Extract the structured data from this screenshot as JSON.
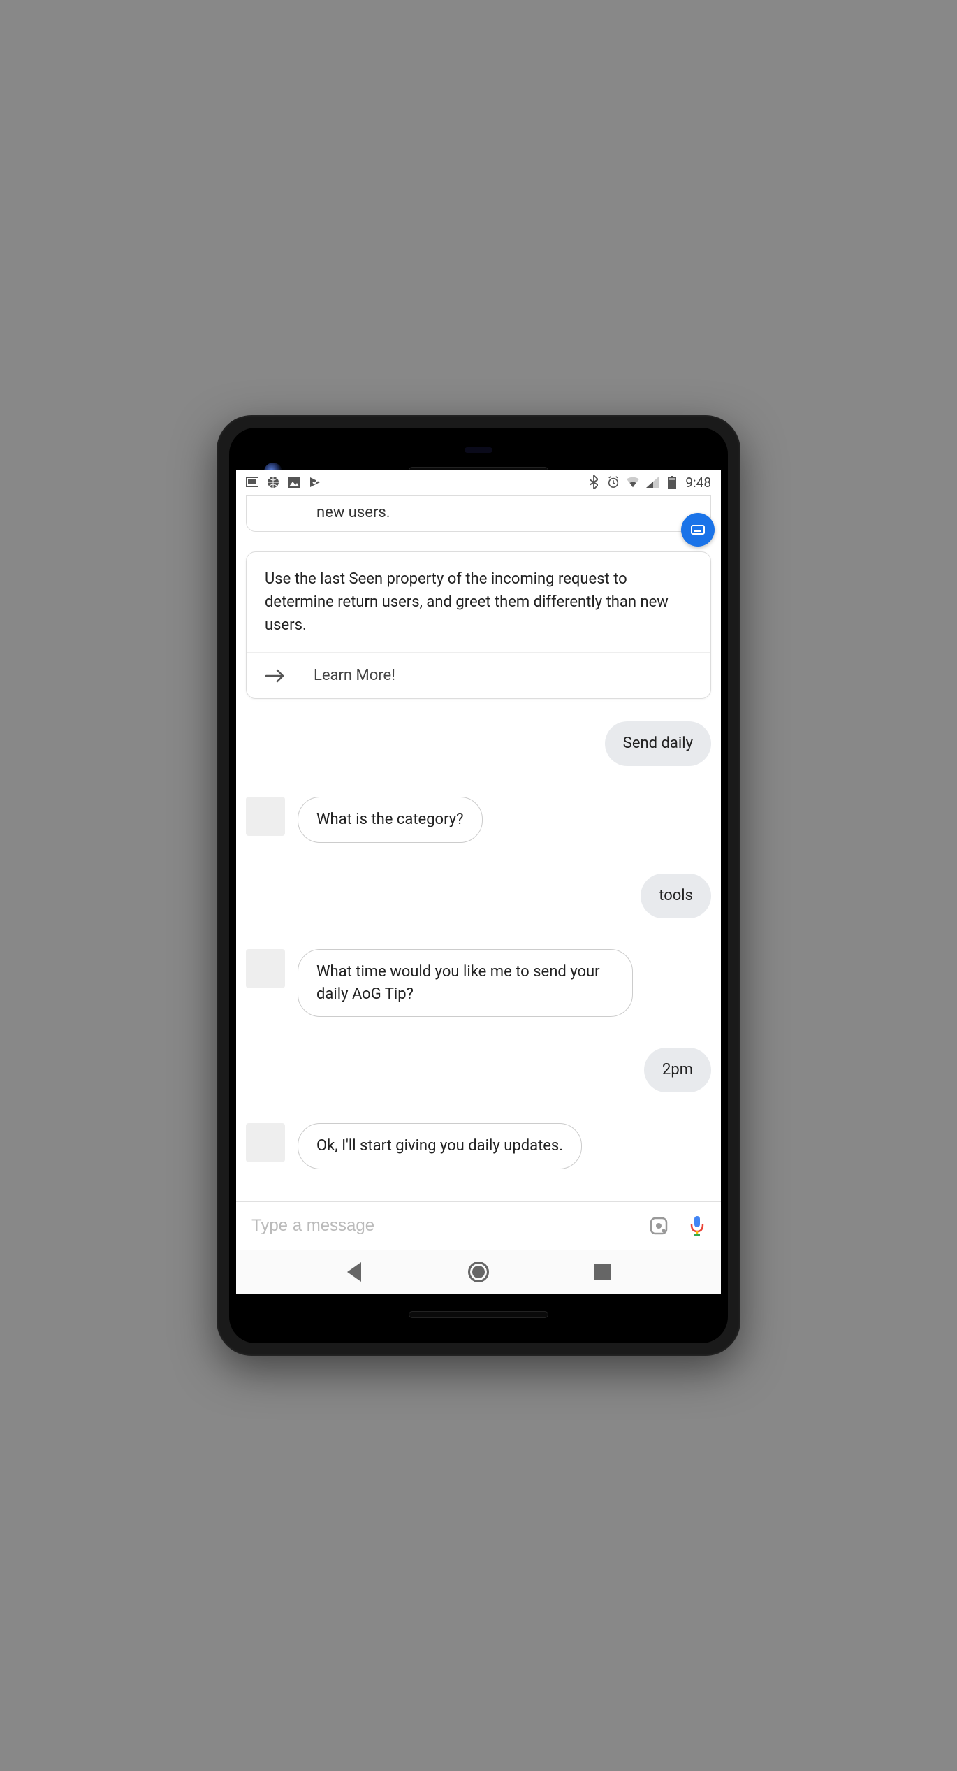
{
  "status": {
    "time": "9:48",
    "icons_left": [
      "screen-icon",
      "basketball-icon",
      "photo-icon",
      "check-icon"
    ],
    "icons_right": [
      "bluetooth-icon",
      "alarm-icon",
      "wifi-icon",
      "cell-icon",
      "battery-icon"
    ]
  },
  "card_cut": {
    "text": "new users."
  },
  "card_full": {
    "body": "Use the last Seen property of the incoming request to determine return users, and greet them differently than new users.",
    "action": "Learn More!"
  },
  "conversation": {
    "m1_user": "Send daily",
    "m2_bot": "What is the category?",
    "m3_user": "tools",
    "m4_bot": "What time would you like me to send your daily AoG Tip?",
    "m5_user": "2pm",
    "m6_bot": "Ok, I'll start giving you daily updates."
  },
  "input": {
    "placeholder": "Type a message"
  }
}
